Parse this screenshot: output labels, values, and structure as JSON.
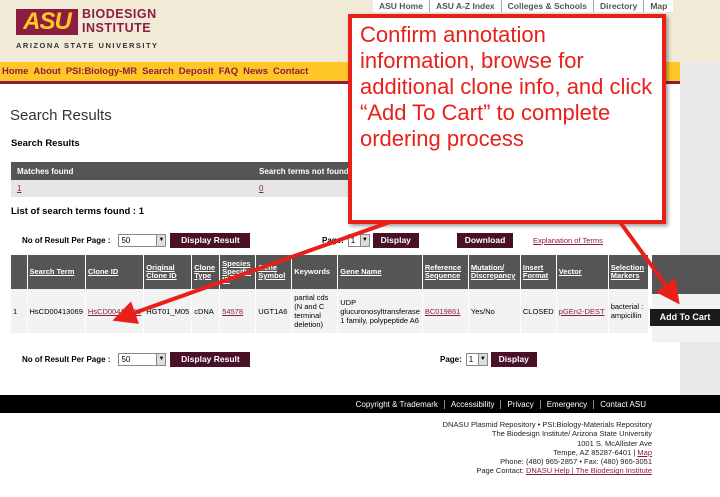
{
  "header": {
    "logo_asu": "ASU",
    "logo_line1": "BIODESIGN",
    "logo_line2": "INSTITUTE",
    "logo_sub": "ARIZONA STATE UNIVERSITY",
    "top_links": [
      "ASU Home",
      "ASU A-Z Index",
      "Colleges & Schools",
      "Directory",
      "Map"
    ]
  },
  "nav": [
    "Home",
    "About",
    "PSI:Biology-MR",
    "Search",
    "Deposit",
    "FAQ",
    "News",
    "Contact"
  ],
  "page_title": "Search Results",
  "section_title": "Search Results",
  "summary": {
    "headers": [
      "Matches found",
      "Search terms not found"
    ],
    "matches_value": "1",
    "not_found_value": "0"
  },
  "list_title": "List of search terms found : 1",
  "controls": {
    "rpp_label": "No of Result Per Page :",
    "rpp_value": "50",
    "display_result_label": "Display Result",
    "page_label": "Page:",
    "page_value": "1",
    "display_label": "Display",
    "download_label": "Download",
    "explanation_label": "Explanation of Terms"
  },
  "table": {
    "columns": [
      "Search Term",
      "Clone ID",
      "Original Clone ID",
      "Clone Type",
      "Species Specific ID",
      "Gene Symbol",
      "Keywords",
      "Gene Name",
      "Reference Sequence",
      "Mutation/ Discrepancy",
      "Insert Format",
      "Vector",
      "Selection Markers"
    ],
    "rows": [
      {
        "num": "1",
        "search_term": "HsCD00413069",
        "clone_id": "HsCD00413069",
        "original_clone_id": "HGT01_M05",
        "clone_type": "cDNA",
        "species_id": "54578",
        "gene_symbol": "UGT1A6",
        "keywords": "partial cds (N and C terminal deletion)",
        "gene_name": "UDP glucuronosyltransferase 1 family, polypeptide A6",
        "reference": "BC019861",
        "mutation": "Yes/No",
        "insert_format": "CLOSED",
        "vector": "pGEn2-DEST",
        "markers": "bacterial : ampicillin"
      }
    ],
    "add_to_cart_label": "Add To Cart"
  },
  "footer": {
    "links": [
      "Copyright & Trademark",
      "Accessibility",
      "Privacy",
      "Emergency",
      "Contact ASU"
    ],
    "line1": "DNASU Plasmid Repository • PSI:Biology-Materials Repository",
    "line2": "The Biodesign Institute/ Arizona State University",
    "line3": "1001 S. McAllister Ave",
    "line4a": "Tempe, AZ 85287-6401 |",
    "line4b": "Map",
    "line5": "Phone: (480) 965-2857 • Fax: (480) 965-3051",
    "line6a": "Page Contact:",
    "line6b": "DNASU Help | The Biodesign Institute"
  },
  "callout": {
    "text": "Confirm annotation information, browse for additional clone info, and click “Add To Cart” to complete ordering process",
    "color": "#e8201a"
  }
}
